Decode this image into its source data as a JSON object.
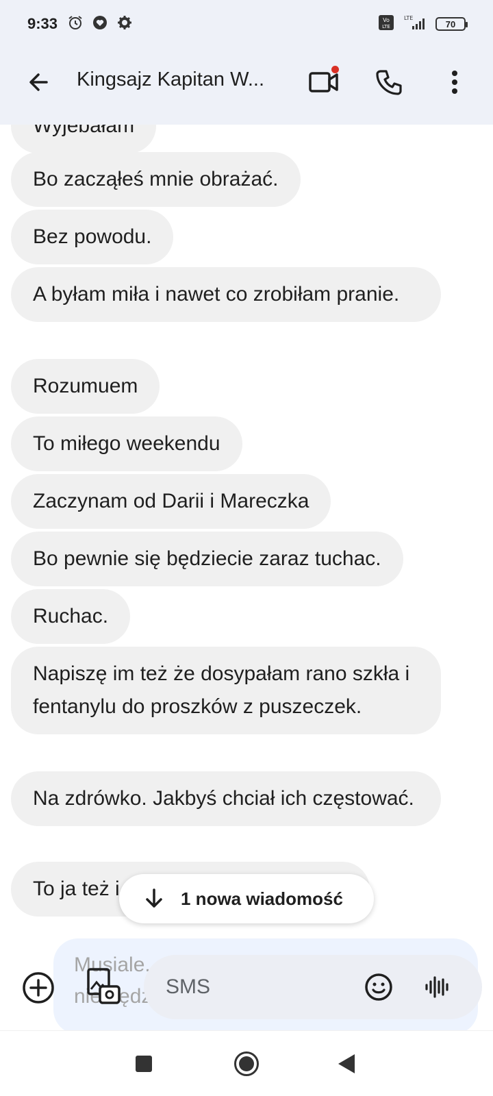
{
  "status_bar": {
    "time": "9:33",
    "left_icons": [
      "alarm-icon",
      "heart-icon",
      "settings-icon"
    ],
    "right_icons": [
      "volte-icon",
      "lte-signal-icon"
    ],
    "battery": "70"
  },
  "app_bar": {
    "title": "Kingsajz Kapitan W...",
    "icons": [
      "back-arrow-icon",
      "video-call-icon",
      "phone-icon",
      "more-vert-icon"
    ],
    "video_notification_color": "#d93025"
  },
  "messages": [
    {
      "text": "Wyjebałam"
    },
    {
      "text": "Bo zacząłeś mnie obrażać."
    },
    {
      "text": "Bez powodu."
    },
    {
      "text": "A byłam miła i nawet co zrobiłam pranie."
    },
    {
      "text": "Rozumuem"
    },
    {
      "text": "To miłego weekendu"
    },
    {
      "text": "Zaczynam od Darii i Mareczka"
    },
    {
      "text": "Bo pewnie się będziecie zaraz tuchac."
    },
    {
      "text": "Ruchac."
    },
    {
      "text": "Napiszę im też że dosypałam rano szkła i fentanylu do proszków z puszeczek."
    },
    {
      "text": "Na zdrówko. Jakbyś chciał ich częstować."
    },
    {
      "text": "To ja też i"
    }
  ],
  "new_message_chip": {
    "label": "1 nowa wiadomość",
    "icon": "arrow-down-icon"
  },
  "outgoing_preview": {
    "text": "Musiale... bo im... skurwysynem podłym nie będziesz"
  },
  "composer": {
    "placeholder": "SMS",
    "icons": [
      "add-icon",
      "gallery-camera-icon",
      "emoji-icon",
      "voice-icon"
    ]
  },
  "nav_bar": {
    "icons": [
      "recents-icon",
      "home-icon",
      "back-icon"
    ]
  },
  "colors": {
    "incoming_bubble": "#f0f0f0",
    "outgoing_bubble": "#d3e3fd",
    "header_bg": "#eef1f8"
  }
}
